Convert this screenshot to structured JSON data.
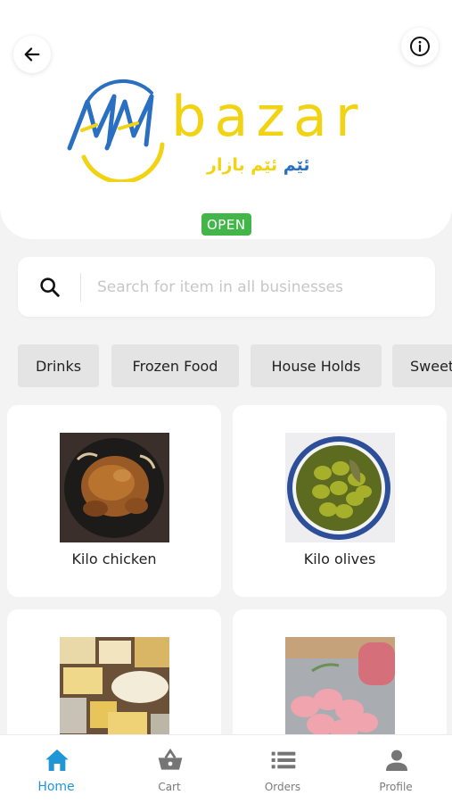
{
  "header": {
    "logo": {
      "wordmark": "bazar",
      "monogram": "MM",
      "subtitle_part1": "ئێم",
      "subtitle_part2": "ئێم",
      "subtitle_part3": "بازار"
    },
    "status": "OPEN",
    "back_icon": "arrow-left-icon",
    "info_icon": "info-icon"
  },
  "search": {
    "placeholder": "Search for item in all businesses",
    "value": ""
  },
  "categories": [
    "Drinks",
    "Frozen Food",
    "House Holds",
    "Sweets"
  ],
  "products": [
    {
      "name": "Kilo chicken",
      "image": "roast-chicken-image"
    },
    {
      "name": "Kilo olives",
      "image": "olives-bowl-image"
    },
    {
      "name": "",
      "image": "cheese-assortment-image"
    },
    {
      "name": "",
      "image": "cold-cuts-image"
    }
  ],
  "nav": [
    {
      "label": "Home",
      "icon": "home-icon",
      "active": true
    },
    {
      "label": "Cart",
      "icon": "basket-icon",
      "active": false
    },
    {
      "label": "Orders",
      "icon": "list-icon",
      "active": false
    },
    {
      "label": "Profile",
      "icon": "user-icon",
      "active": false
    }
  ],
  "colors": {
    "brand_yellow": "#f2d314",
    "brand_blue": "#2b6fc2",
    "status_green": "#43b649",
    "nav_active": "#2196d6",
    "background": "#f3f3f3"
  }
}
